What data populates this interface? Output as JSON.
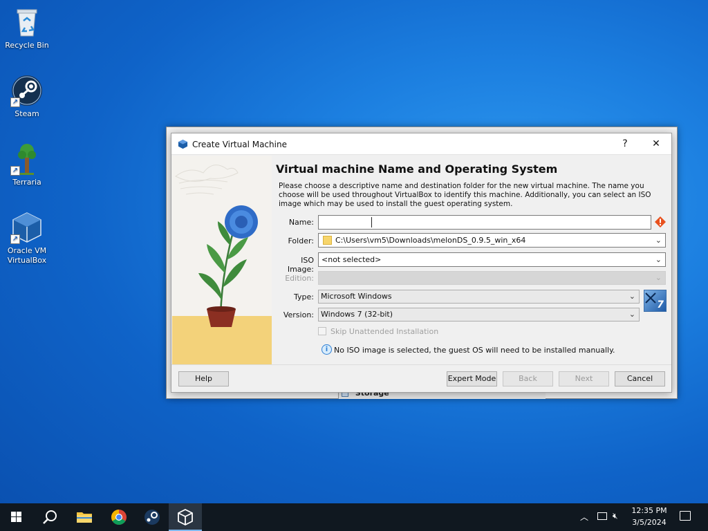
{
  "desktop": {
    "icons": [
      {
        "label": "Recycle Bin"
      },
      {
        "label": "Steam"
      },
      {
        "label": "Terraria"
      },
      {
        "label": "Oracle VM VirtualBox"
      }
    ]
  },
  "background_window": {
    "storage_label": "Storage"
  },
  "dialog": {
    "title": "Create Virtual Machine",
    "help_char": "?",
    "close_char": "✕",
    "heading": "Virtual machine Name and Operating System",
    "description": "Please choose a descriptive name and destination folder for the new virtual machine. The name you choose will be used throughout VirtualBox to identify this machine. Additionally, you can select an ISO image which may be used to install the guest operating system.",
    "form": {
      "name_label": "Name:",
      "name_value": "",
      "folder_label": "Folder:",
      "folder_value": "C:\\Users\\vm5\\Downloads\\melonDS_0.9.5_win_x64",
      "iso_label": "ISO Image:",
      "iso_value": "<not selected>",
      "edition_label": "Edition:",
      "edition_value": "",
      "type_label": "Type:",
      "type_value": "Microsoft Windows",
      "version_label": "Version:",
      "version_value": "Windows 7 (32-bit)",
      "os_badge": "7",
      "skip_unattended_label": "Skip Unattended Installation",
      "info_message": "No ISO image is selected, the guest OS will need to be installed manually."
    },
    "buttons": {
      "help": "Help",
      "expert_mode": "Expert Mode",
      "back": "Back",
      "next": "Next",
      "cancel": "Cancel"
    }
  },
  "taskbar": {
    "clock_time": "12:35 PM",
    "clock_date": "3/5/2024"
  },
  "colors": {
    "desktop_blue": "#1c7fe0",
    "taskbar": "#101820",
    "error_orange": "#e8501d",
    "info_blue": "#2e7fd6"
  }
}
